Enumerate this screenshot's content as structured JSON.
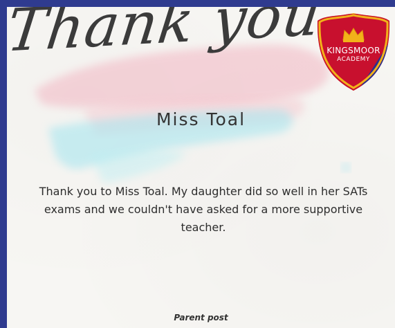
{
  "card": {
    "heading": "Thank you",
    "teacher_name": "Miss Toal",
    "message": "Thank you to Miss Toal. My daughter did so well in her SATs exams and we couldn't have asked for a more supportive teacher.",
    "footer_label": "Parent post"
  },
  "badge": {
    "line1": "KINGSMOOR",
    "line2": "ACADEMY",
    "icon": "crown-icon",
    "colors": {
      "red": "#c8102e",
      "navy": "#2b2f8f",
      "gold": "#f2b21a"
    }
  },
  "colors": {
    "frame": "#2f3b8f",
    "paper": "#f7f6f3",
    "brush_pink": "#f2b6c2",
    "brush_blue": "#a9e6ef"
  }
}
